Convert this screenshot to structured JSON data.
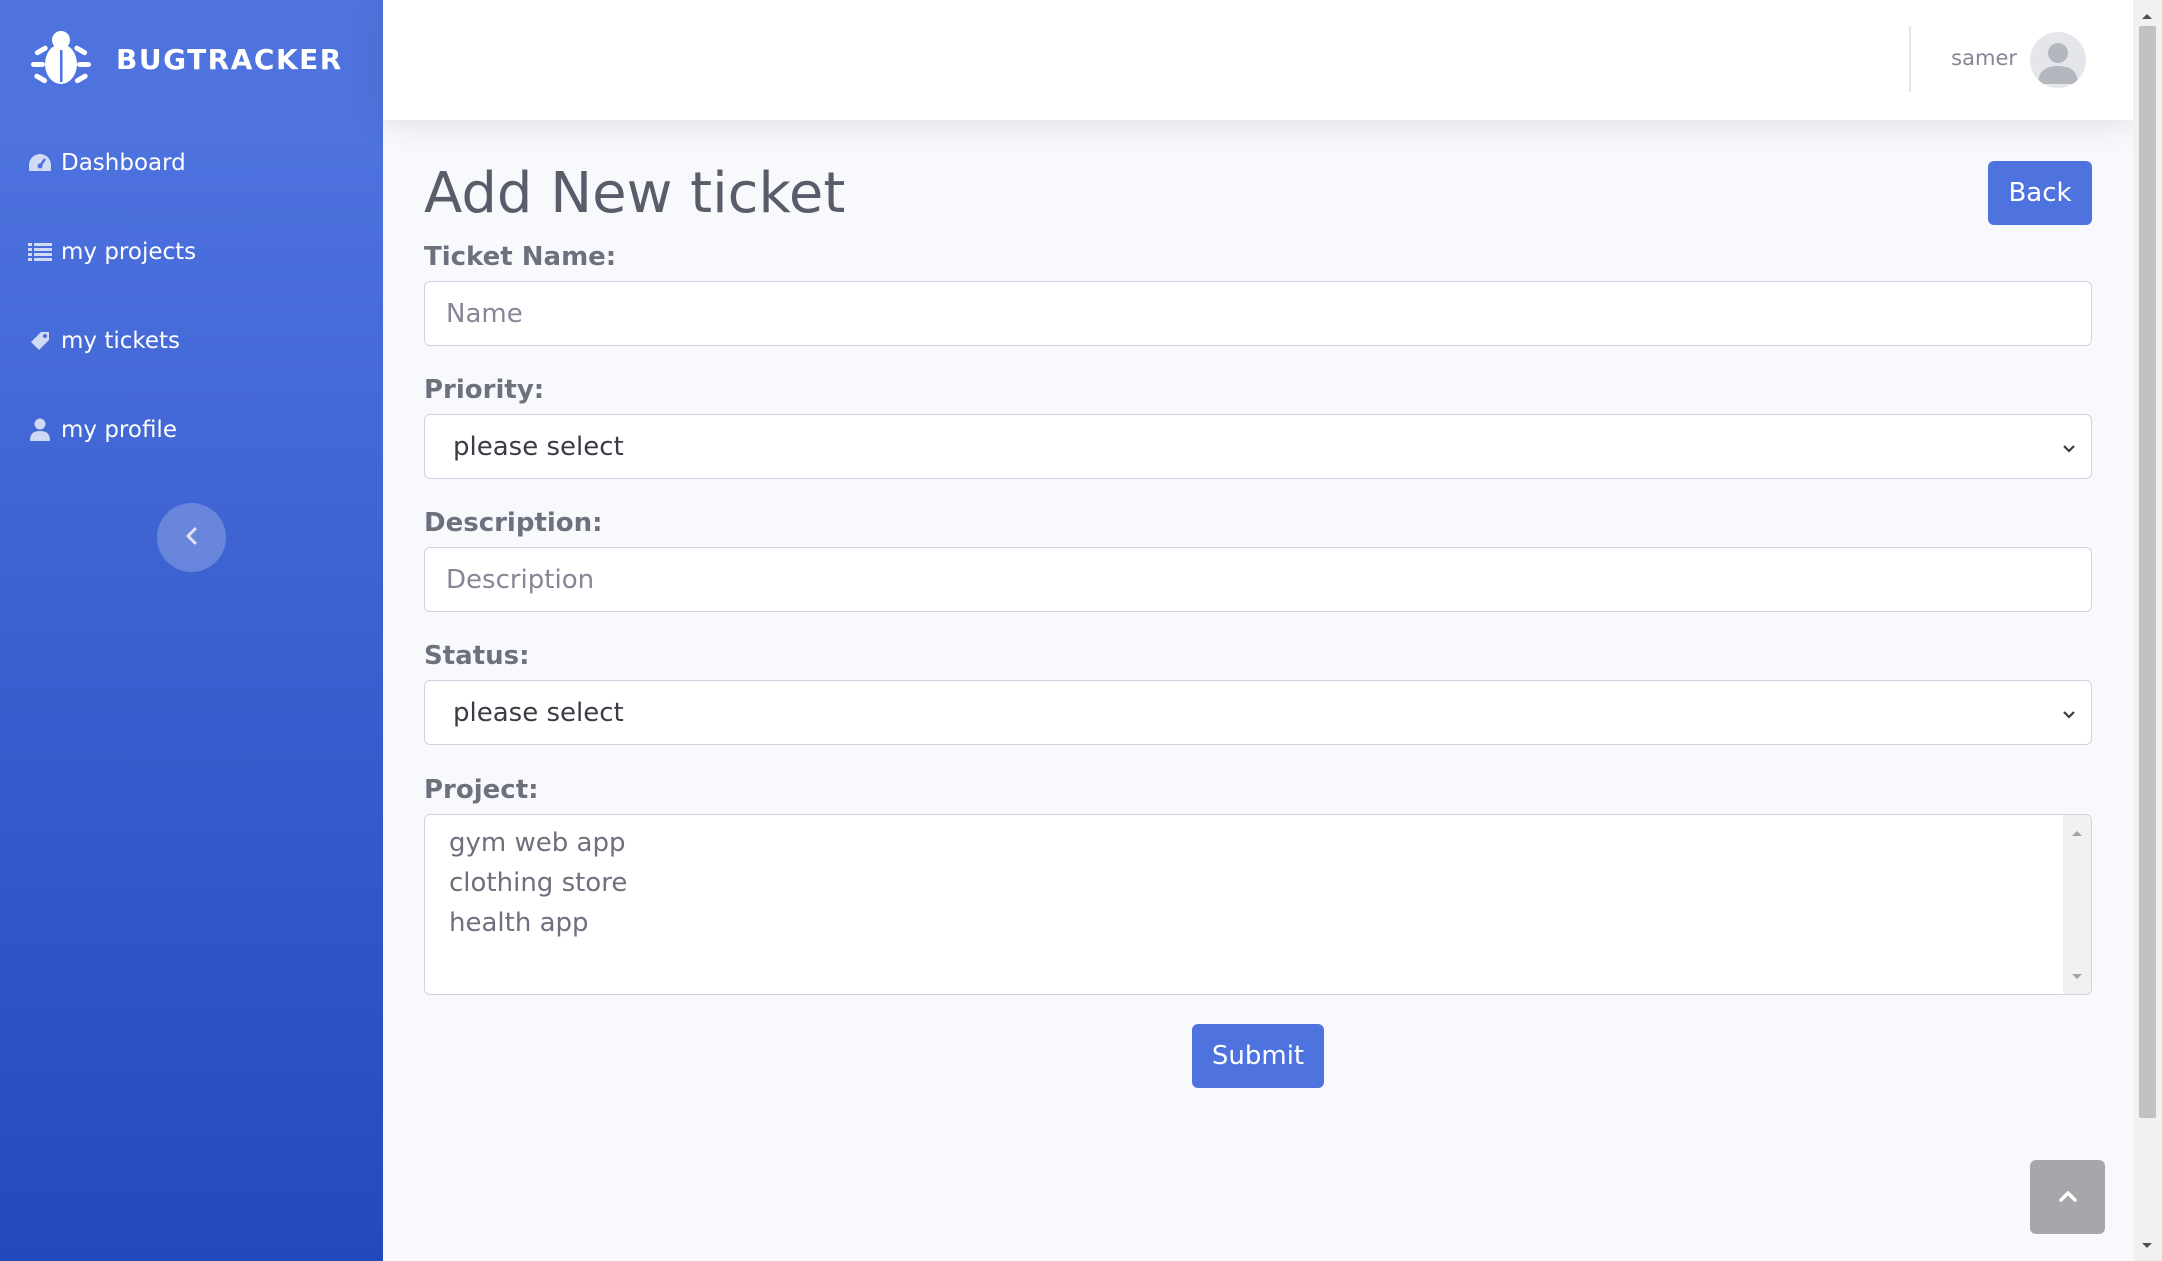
{
  "sidebar": {
    "brand": "BUGTRACKER",
    "items": [
      {
        "label": "Dashboard",
        "icon": "tachometer-icon"
      },
      {
        "label": "my projects",
        "icon": "list-icon"
      },
      {
        "label": "my tickets",
        "icon": "ticket-icon"
      },
      {
        "label": "my profile",
        "icon": "user-icon"
      }
    ],
    "toggle_icon": "chevron-left-icon"
  },
  "topbar": {
    "user_name": "samer",
    "avatar_icon": "user-avatar-icon"
  },
  "main": {
    "title": "Add New ticket",
    "back_label": "Back",
    "form": {
      "ticket_name": {
        "label": "Ticket Name:",
        "placeholder": "Name"
      },
      "priority": {
        "label": "Priority:",
        "value": "please select"
      },
      "description": {
        "label": "Description:",
        "placeholder": "Description"
      },
      "status": {
        "label": "Status:",
        "value": "please select"
      },
      "project": {
        "label": "Project:",
        "options": [
          "gym web app",
          "clothing store",
          "health app"
        ]
      }
    },
    "submit_label": "Submit"
  },
  "colors": {
    "primary": "#4e73df",
    "sidebar_gradient_end": "#224abe",
    "background": "#f8f9fc",
    "text": "#858796"
  }
}
